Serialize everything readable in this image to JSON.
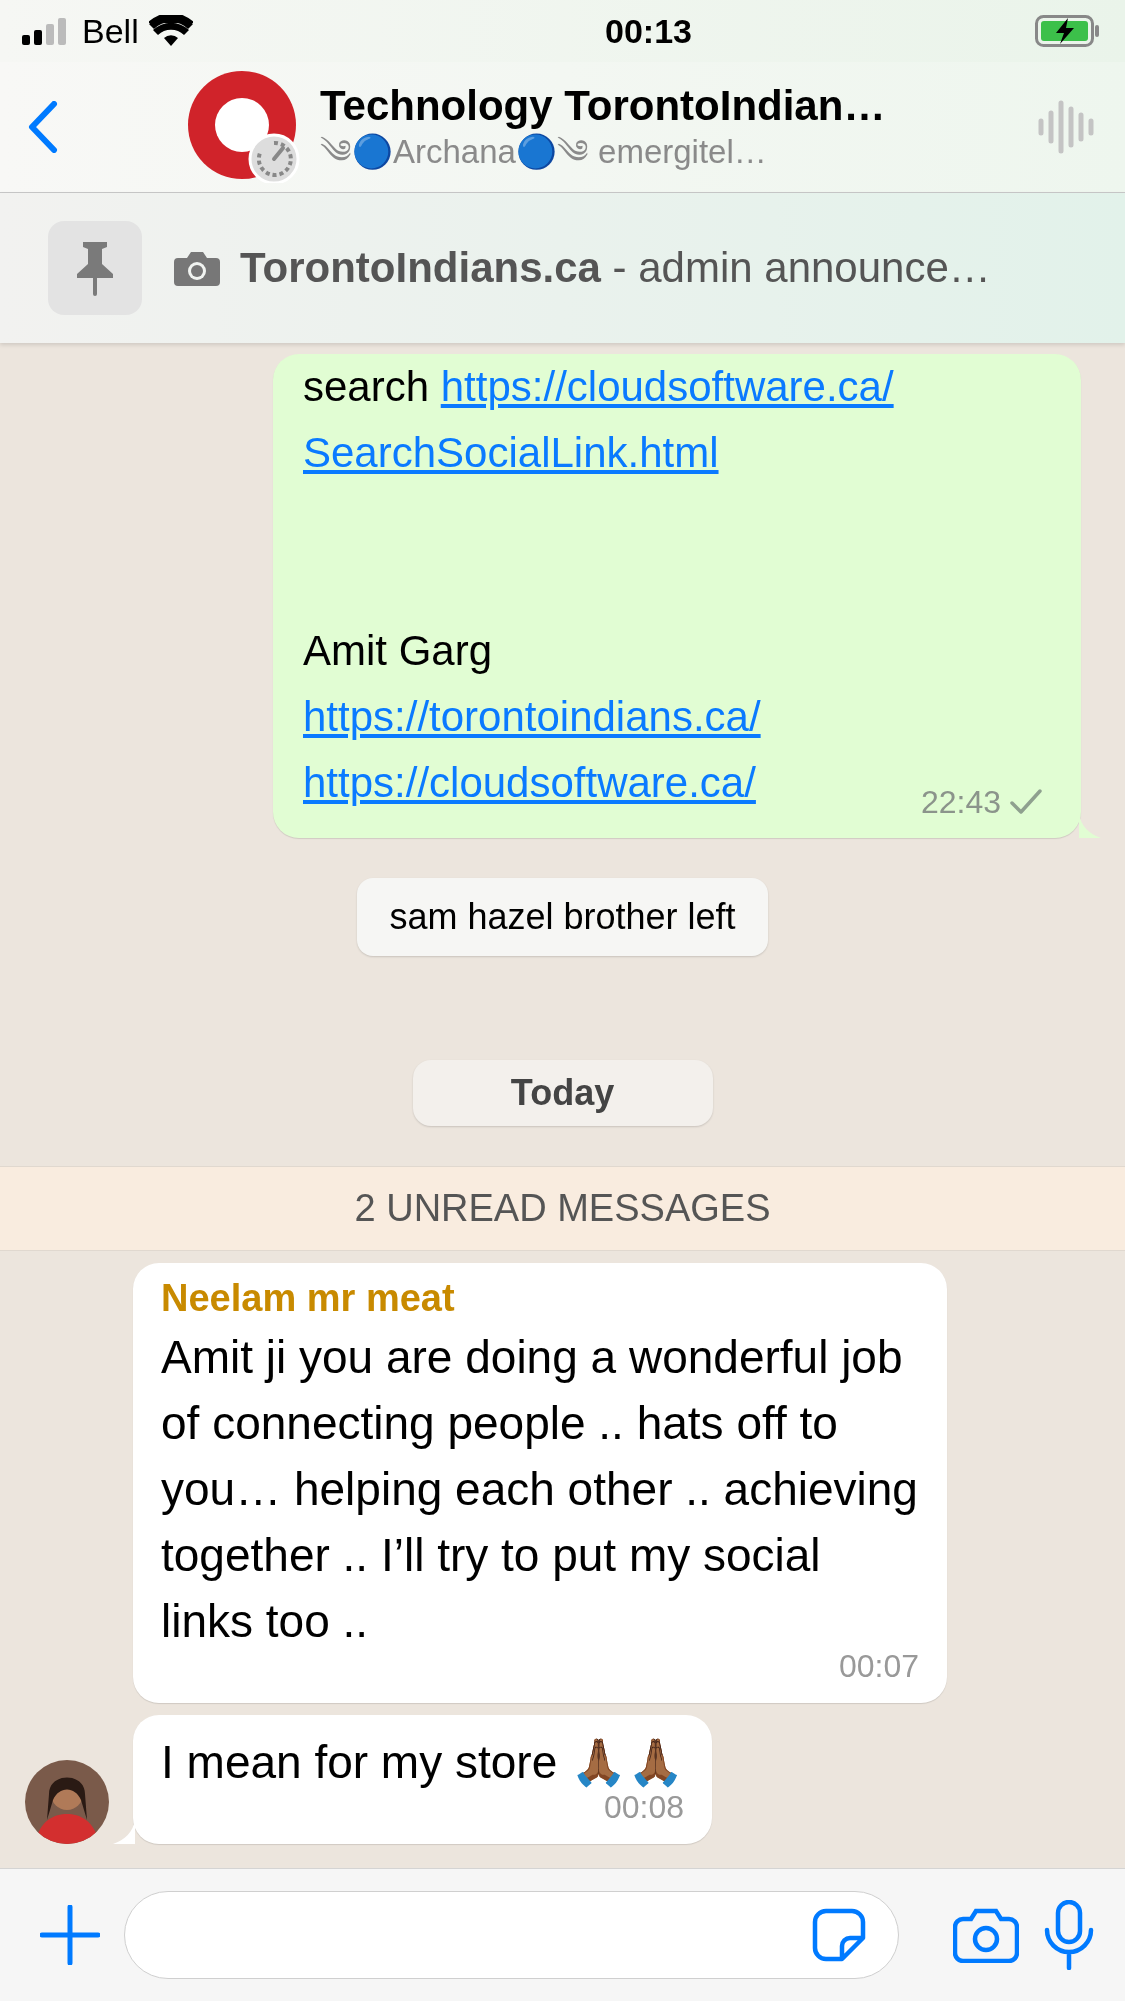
{
  "status_bar": {
    "carrier": "Bell",
    "time": "00:13",
    "charging": true
  },
  "header": {
    "title": "Technology TorontoIndian…",
    "subtitle": "༄🔵Archana🔵༄ emergitel…"
  },
  "pinned": {
    "sender": "TorontoIndians.ca",
    "text": " - admin announce…"
  },
  "messages": [
    {
      "kind": "outgoing",
      "lines": [
        {
          "kind": "text",
          "parts": [
            {
              "text": "search "
            },
            {
              "link": "https://cloudsoftware.ca/"
            }
          ]
        },
        {
          "kind": "text",
          "parts": [
            {
              "link": "SearchSocialLink.html"
            }
          ]
        },
        {
          "kind": "blank"
        },
        {
          "kind": "blank"
        },
        {
          "kind": "text",
          "parts": [
            {
              "text": "Amit Garg"
            }
          ]
        },
        {
          "kind": "text",
          "parts": [
            {
              "link": "https://torontoindians.ca/"
            }
          ]
        },
        {
          "kind": "text",
          "parts": [
            {
              "link": "https://cloudsoftware.ca/"
            }
          ]
        }
      ],
      "time": "22:43",
      "delivered": false,
      "tail": true
    },
    {
      "kind": "system",
      "text": "sam hazel brother left"
    },
    {
      "kind": "date",
      "text": "Today"
    },
    {
      "kind": "unread",
      "text": "2 UNREAD MESSAGES"
    },
    {
      "kind": "incoming",
      "sender": "Neelam mr meat",
      "color": "#c88a00",
      "text": "Amit ji you are doing a wonderful job of connecting people .. hats off to you… helping each other .. achieving together .. I’ll try to put my social links too ..",
      "time": "00:07",
      "tail": false,
      "avatar": false
    },
    {
      "kind": "incoming",
      "text": "I mean for my store 🙏🏾🙏🏾",
      "time": "00:08",
      "tail": true,
      "avatar": true
    }
  ]
}
